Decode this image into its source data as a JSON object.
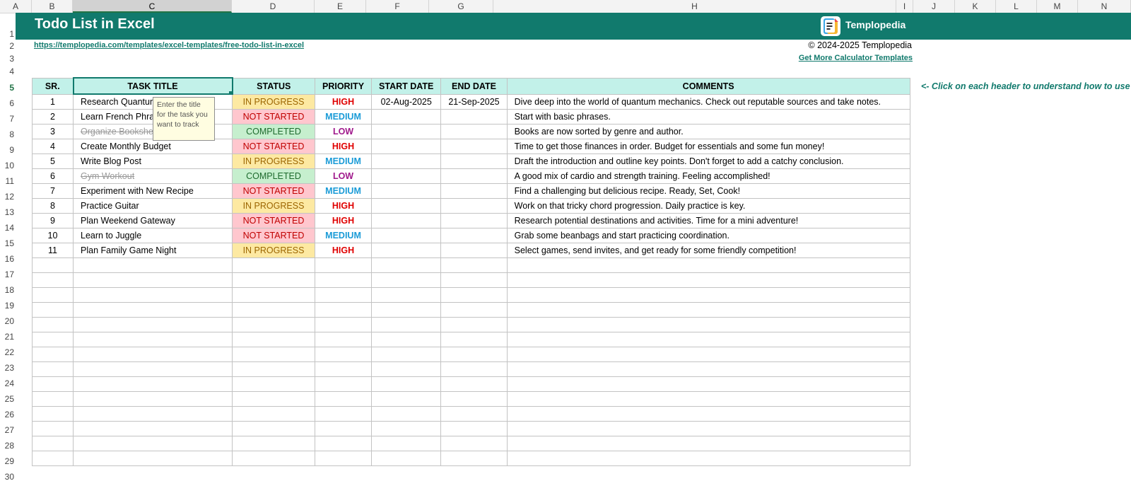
{
  "columns": [
    "A",
    "B",
    "C",
    "D",
    "E",
    "F",
    "G",
    "H",
    "I",
    "J",
    "K",
    "L",
    "M",
    "N"
  ],
  "selected_column": "C",
  "rows": [
    "1",
    "2",
    "3",
    "4",
    "5",
    "6",
    "7",
    "8",
    "9",
    "10",
    "11",
    "12",
    "13",
    "14",
    "15",
    "16",
    "17",
    "18",
    "19",
    "20",
    "21",
    "22",
    "23",
    "24",
    "25",
    "26",
    "27",
    "28",
    "29",
    "30"
  ],
  "selected_row": "5",
  "banner": {
    "title": "Todo List in Excel",
    "logo_text": "Templopedia",
    "color": "#117a6d"
  },
  "links": {
    "url": "https://templopedia.com/templates/excel-templates/free-todo-list-in-excel",
    "copyright": "© 2024-2025 Templopedia",
    "more_templates": "Get More Calculator Templates"
  },
  "hint": "<- Click on each header to understand how to use",
  "headers": {
    "sr": "SR.",
    "title": "TASK TITLE",
    "status": "STATUS",
    "priority": "PRIORITY",
    "start": "START DATE",
    "end": "END DATE",
    "comments": "COMMENTS"
  },
  "tasks": [
    {
      "sr": "1",
      "title": "Research Quantum Physics",
      "status": "IN PROGRESS",
      "priority": "HIGH",
      "start": "02-Aug-2025",
      "end": "21-Sep-2025",
      "comments": "Dive deep into the world of quantum mechanics. Check out reputable sources and take notes."
    },
    {
      "sr": "2",
      "title": "Learn French Phrases",
      "status": "NOT STARTED",
      "priority": "MEDIUM",
      "start": "",
      "end": "",
      "comments": "Start with basic phrases."
    },
    {
      "sr": "3",
      "title": "Organize Bookshelf",
      "status": "COMPLETED",
      "priority": "LOW",
      "start": "",
      "end": "",
      "comments": "Books are now sorted by genre and author."
    },
    {
      "sr": "4",
      "title": "Create Monthly Budget",
      "status": "NOT STARTED",
      "priority": "HIGH",
      "start": "",
      "end": "",
      "comments": "Time to get those finances in order. Budget for essentials and some fun money!"
    },
    {
      "sr": "5",
      "title": "Write Blog Post",
      "status": "IN PROGRESS",
      "priority": "MEDIUM",
      "start": "",
      "end": "",
      "comments": "Draft the introduction and outline key points. Don't forget to add a catchy conclusion."
    },
    {
      "sr": "6",
      "title": "Gym Workout",
      "status": "COMPLETED",
      "priority": "LOW",
      "start": "",
      "end": "",
      "comments": "A good mix of cardio and strength training. Feeling accomplished!"
    },
    {
      "sr": "7",
      "title": "Experiment with New Recipe",
      "status": "NOT STARTED",
      "priority": "MEDIUM",
      "start": "",
      "end": "",
      "comments": "Find a challenging but delicious recipe. Ready, Set, Cook!"
    },
    {
      "sr": "8",
      "title": "Practice Guitar",
      "status": "IN PROGRESS",
      "priority": "HIGH",
      "start": "",
      "end": "",
      "comments": "Work on that tricky chord progression. Daily practice is key."
    },
    {
      "sr": "9",
      "title": "Plan Weekend Gateway",
      "status": "NOT STARTED",
      "priority": "HIGH",
      "start": "",
      "end": "",
      "comments": "Research potential destinations and activities. Time for a mini adventure!"
    },
    {
      "sr": "10",
      "title": "Learn to Juggle",
      "status": "NOT STARTED",
      "priority": "MEDIUM",
      "start": "",
      "end": "",
      "comments": "Grab some beanbags and start practicing coordination."
    },
    {
      "sr": "11",
      "title": "Plan Family Game Night",
      "status": "IN PROGRESS",
      "priority": "HIGH",
      "start": "",
      "end": "",
      "comments": "Select games, send invites, and get ready for some friendly competition!"
    }
  ],
  "empty_rows": 14,
  "tooltip": "Enter the title for the task you want to track"
}
